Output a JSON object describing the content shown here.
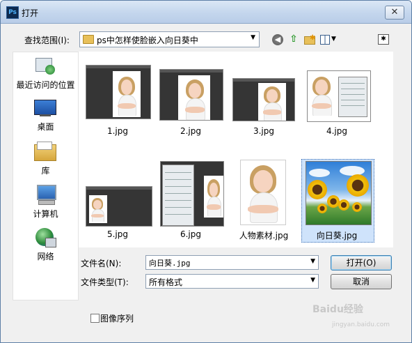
{
  "window": {
    "title": "打开",
    "app_icon": "Ps"
  },
  "toolbar": {
    "look_in_label": "查找范围(I):",
    "look_in_value": "ps中怎样使脸嵌入向日葵中"
  },
  "places": [
    {
      "label": "最近访问的位置",
      "icon": "recent-places-icon"
    },
    {
      "label": "桌面",
      "icon": "desktop-icon"
    },
    {
      "label": "库",
      "icon": "libraries-icon"
    },
    {
      "label": "计算机",
      "icon": "computer-icon"
    },
    {
      "label": "网络",
      "icon": "network-icon"
    }
  ],
  "files": [
    {
      "name": "1.jpg"
    },
    {
      "name": "2.jpg"
    },
    {
      "name": "3.jpg"
    },
    {
      "name": "4.jpg"
    },
    {
      "name": "5.jpg"
    },
    {
      "name": "6.jpg"
    },
    {
      "name": "人物素材.jpg"
    },
    {
      "name": "向日葵.jpg",
      "selected": true
    }
  ],
  "form": {
    "filename_label": "文件名(N):",
    "filename_value": "向日葵.jpg",
    "filetype_label": "文件类型(T):",
    "filetype_value": "所有格式",
    "open_label": "打开(O)",
    "cancel_label": "取消",
    "image_sequence_label": "图像序列"
  },
  "watermark": {
    "text": "Baidu经验",
    "url": "jingyan.baidu.com"
  },
  "colors": {
    "selection": "#cfe3fb",
    "title_bar": "#c4d6ed"
  }
}
